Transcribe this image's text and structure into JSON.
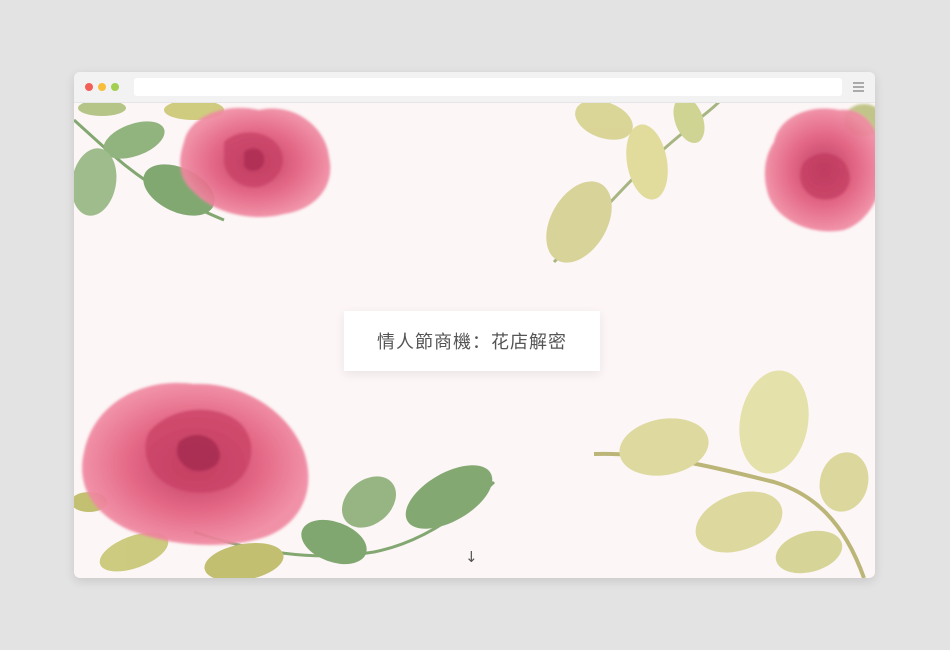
{
  "hero": {
    "title": "情人節商機：花店解密",
    "scroll_hint": "↓"
  },
  "icons": {
    "window_controls": [
      "close-dot",
      "minimize-dot",
      "maximize-dot"
    ],
    "menu": "hamburger-menu-icon",
    "decoration": "watercolor-rose-illustration"
  },
  "colors": {
    "page_background": "#e3e3e3",
    "canvas_background": "#fcf6f6",
    "rose": "#e0577a",
    "leaf_green": "#6f9a5a",
    "leaf_olive": "#c5c266",
    "title_text": "#555555"
  }
}
